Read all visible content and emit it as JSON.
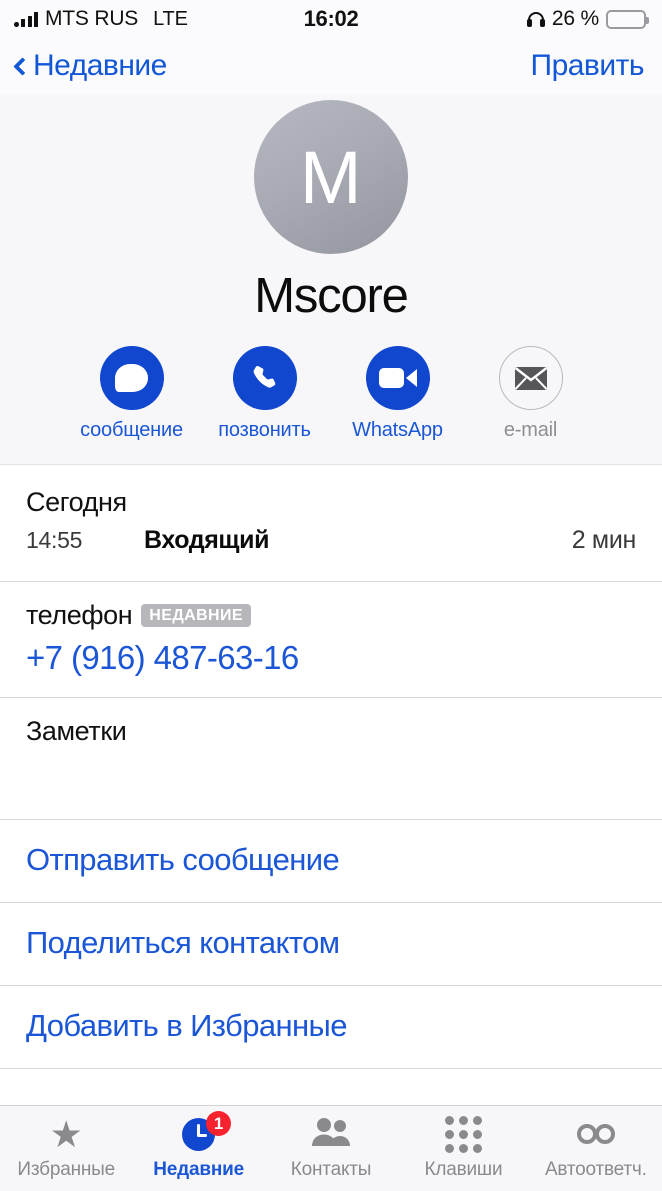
{
  "status_bar": {
    "carrier": "MTS RUS",
    "network_type": "LTE",
    "time": "16:02",
    "battery_percent": "26 %",
    "battery_level": 26,
    "battery_color": "#f5c518",
    "signal_bars": 4,
    "headphones_connected": true
  },
  "nav": {
    "back_label": "Недавние",
    "edit_label": "Править"
  },
  "contact": {
    "initial": "M",
    "name": "Mscore",
    "actions": [
      {
        "label": "сообщение",
        "icon": "message-bubble-icon",
        "enabled": true
      },
      {
        "label": "позвонить",
        "icon": "phone-handset-icon",
        "enabled": true
      },
      {
        "label": "WhatsApp",
        "icon": "video-camera-icon",
        "enabled": true
      },
      {
        "label": "e-mail",
        "icon": "envelope-icon",
        "enabled": false
      }
    ]
  },
  "call_history": {
    "day_label": "Сегодня",
    "entries": [
      {
        "time": "14:55",
        "type": "Входящий",
        "duration": "2 мин"
      }
    ]
  },
  "phone": {
    "label": "телефон",
    "badge": "НЕДАВНИЕ",
    "number": "+7 (916) 487-63-16"
  },
  "notes": {
    "label": "Заметки",
    "value": ""
  },
  "links": [
    {
      "label": "Отправить сообщение"
    },
    {
      "label": "Поделиться контактом"
    },
    {
      "label": "Добавить в Избранные"
    }
  ],
  "tab_bar": {
    "tabs": [
      {
        "label": "Избранные",
        "icon": "star-icon",
        "active": false,
        "badge": ""
      },
      {
        "label": "Недавние",
        "icon": "clock-icon",
        "active": true,
        "badge": "1"
      },
      {
        "label": "Контакты",
        "icon": "people-icon",
        "active": false,
        "badge": ""
      },
      {
        "label": "Клавиши",
        "icon": "keypad-icon",
        "active": false,
        "badge": ""
      },
      {
        "label": "Автоответч.",
        "icon": "voicemail-icon",
        "active": false,
        "badge": ""
      }
    ]
  },
  "colors": {
    "accent_blue": "#1a56d6",
    "icon_blue": "#1146cf",
    "badge_red": "#f6222e",
    "muted_gray": "#8a8a8e",
    "header_bg": "#f7f7fa"
  }
}
